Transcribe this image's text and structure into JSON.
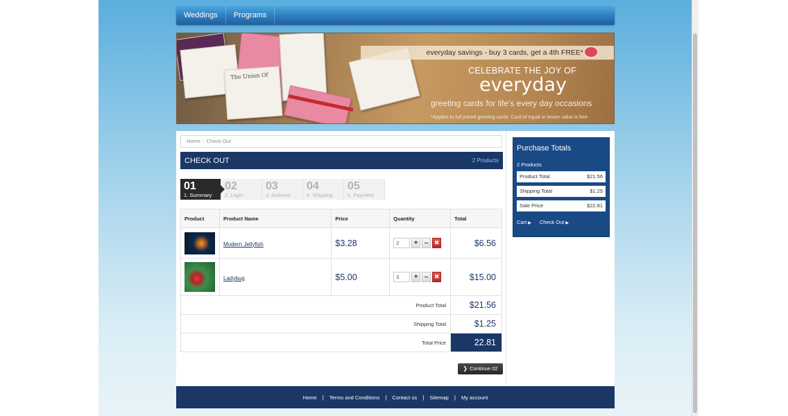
{
  "nav": {
    "items": [
      "Weddings",
      "Programs"
    ]
  },
  "banner": {
    "savings": "everyday savings - buy 3 cards, get a 4th FREE*",
    "celebrate": "CELEBRATE THE JOY OF",
    "everyday": "everyday",
    "greeting": "greeting cards for life's every day occasions",
    "note": "*Applies to full priced greeting cards. Card of equal or lesser value is free",
    "card_text": "The Union Of"
  },
  "breadcrumb": {
    "home": "Home",
    "separator": "›",
    "current": "Check Out"
  },
  "checkout": {
    "title": "CHECK OUT",
    "count": "2 Products"
  },
  "steps": [
    {
      "num": "01",
      "label": "1. Summary"
    },
    {
      "num": "02",
      "label": "2. Login"
    },
    {
      "num": "03",
      "label": "3. Address"
    },
    {
      "num": "04",
      "label": "4. Shipping"
    },
    {
      "num": "05",
      "label": "5. Payment"
    }
  ],
  "table": {
    "headers": {
      "product": "Product",
      "name": "Product Name",
      "price": "Price",
      "quantity": "Quantity",
      "total": "Total"
    },
    "rows": [
      {
        "name": "Modern Jellyfish",
        "price": "$3.28",
        "qty": "2",
        "total": "$6.56"
      },
      {
        "name": "Ladybug",
        "price": "$5.00",
        "qty": "3",
        "total": "$15.00"
      }
    ],
    "qty_plus": "+",
    "qty_minus": "–",
    "qty_delete": "✖",
    "summary": {
      "product_total_label": "Product Total",
      "product_total": "$21.56",
      "shipping_total_label": "Shipping Total",
      "shipping_total": "$1.25",
      "total_price_label": "Total Price",
      "total_price": "22.81"
    }
  },
  "continue_label": "Continue 02",
  "sidebar": {
    "title": "Purchase Totals",
    "count": "2 Products",
    "rows": [
      {
        "label": "Product Total",
        "value": "$21.56"
      },
      {
        "label": "Shipping Total",
        "value": "$1.25"
      },
      {
        "label": "Sale Price",
        "value": "$22.81"
      }
    ],
    "cart_label": "Cart",
    "checkout_label": "Check Out"
  },
  "footer": {
    "links": [
      "Home",
      "Terms and Conditions",
      "Contact us",
      "Sitemap",
      "My account"
    ]
  },
  "colors": {
    "navy": "#1a3766",
    "sidebar": "#1a4a86",
    "accent_link": "#7fd0ff"
  }
}
